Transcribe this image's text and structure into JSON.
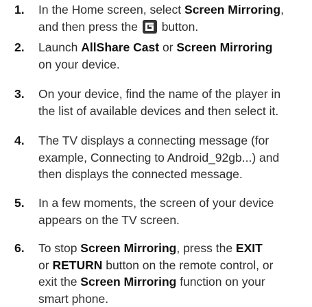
{
  "steps": [
    {
      "number": "1.",
      "lines": [
        [
          "In the Home screen, select ",
          {
            "b": "Screen Mirroring"
          },
          ","
        ],
        [
          "and then press the ",
          {
            "icon": "source-button-icon"
          },
          " button."
        ]
      ]
    },
    {
      "number": "2.",
      "lines": [
        [
          "Launch ",
          {
            "b": "AllShare Cast"
          },
          " or ",
          {
            "b": "Screen Mirroring"
          }
        ],
        [
          "on your device."
        ]
      ]
    },
    {
      "number": "3.",
      "lines": [
        [
          "On your device, find the name of the player in"
        ],
        [
          "the list of available devices and then select it."
        ]
      ]
    },
    {
      "number": "4.",
      "lines": [
        [
          "The TV displays a connecting message (for"
        ],
        [
          "example, Connecting to Android_92gb...) and"
        ],
        [
          "then displays the connected message."
        ]
      ]
    },
    {
      "number": "5.",
      "lines": [
        [
          "In a few moments, the screen of your device"
        ],
        [
          "appears on the TV screen."
        ]
      ]
    },
    {
      "number": "6.",
      "lines": [
        [
          "To stop ",
          {
            "b": "Screen Mirroring"
          },
          ", press the ",
          {
            "b": "EXIT"
          }
        ],
        [
          "or ",
          {
            "b": "RETURN"
          },
          " button on the remote control, or"
        ],
        [
          "exit the ",
          {
            "b": "Screen Mirroring"
          },
          " function on your"
        ],
        [
          "smart phone."
        ]
      ]
    }
  ]
}
